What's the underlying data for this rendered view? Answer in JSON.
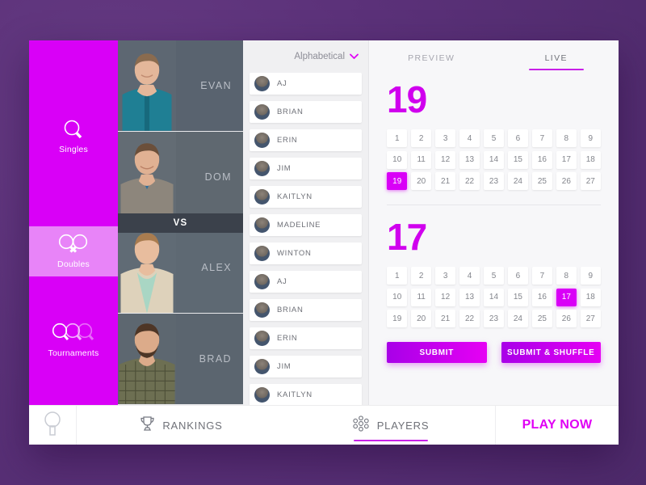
{
  "colors": {
    "magenta": "#d900f7",
    "magenta_light": "#e884f8",
    "accent_underline": "#c820e8",
    "backdrop": "#5a3079",
    "slate": "#3b414b"
  },
  "sidebar": {
    "items": [
      {
        "label": "Singles",
        "icon": "paddle-single-icon",
        "active": false
      },
      {
        "label": "Doubles",
        "icon": "paddle-double-icon",
        "active": true
      },
      {
        "label": "Tournaments",
        "icon": "paddle-triple-icon",
        "active": false
      }
    ]
  },
  "matchup": {
    "vs_label": "VS",
    "players": [
      {
        "name": "EVAN",
        "shirt": "#1f7f94",
        "skin": "#e4b79a",
        "hair": "#8a6b4f"
      },
      {
        "name": "DOM",
        "shirt": "#8d867c",
        "skin": "#e0b193",
        "hair": "#6b4f3a"
      },
      {
        "name": "ALEX",
        "shirt": "#a9d6c4",
        "skin": "#e8bd9e",
        "hair": "#a97c4f"
      },
      {
        "name": "BRAD",
        "shirt": "#6d6f52",
        "skin": "#dcab8a",
        "hair": "#4e3626"
      }
    ]
  },
  "roster": {
    "sort_label": "Alphabetical",
    "sort_icon": "chevron-down-icon",
    "items": [
      {
        "name": "AJ"
      },
      {
        "name": "BRIAN"
      },
      {
        "name": "ERIN"
      },
      {
        "name": "JIM"
      },
      {
        "name": "KAITLYN"
      },
      {
        "name": "MADELINE"
      },
      {
        "name": "WINTON"
      },
      {
        "name": "AJ"
      },
      {
        "name": "BRIAN"
      },
      {
        "name": "ERIN"
      },
      {
        "name": "JIM"
      },
      {
        "name": "KAITLYN"
      }
    ]
  },
  "score_panel": {
    "tabs": [
      {
        "label": "PREVIEW",
        "active": false
      },
      {
        "label": "LIVE",
        "active": true
      }
    ],
    "boards": [
      {
        "score": "19",
        "selected": 19,
        "max": 27
      },
      {
        "score": "17",
        "selected": 17,
        "max": 27
      }
    ],
    "buttons": [
      {
        "label": "SUBMIT"
      },
      {
        "label": "SUBMIT & SHUFFLE"
      }
    ]
  },
  "bottom_bar": {
    "logo_icon": "paddle-logo-icon",
    "tabs": [
      {
        "label": "RANKINGS",
        "icon": "trophy-icon",
        "active": false
      },
      {
        "label": "PLAYERS",
        "icon": "people-cluster-icon",
        "active": true
      }
    ],
    "play_now": "PLAY NOW"
  }
}
